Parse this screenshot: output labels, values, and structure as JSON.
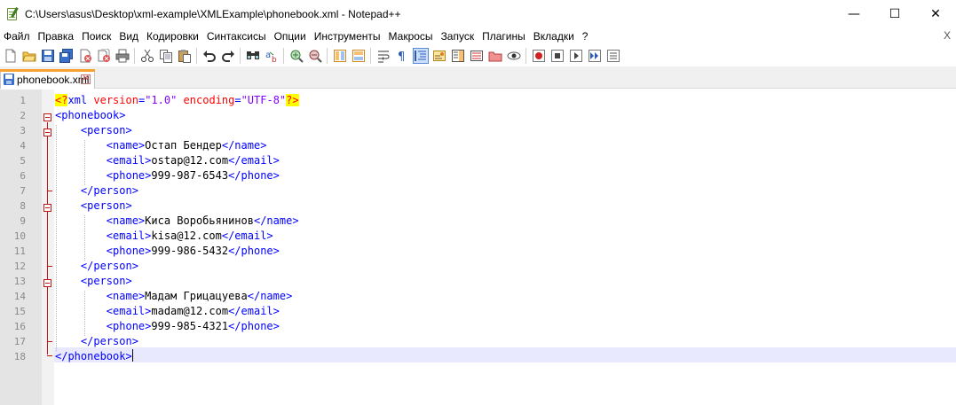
{
  "window": {
    "title": "C:\\Users\\asus\\Desktop\\xml-example\\XMLExample\\phonebook.xml - Notepad++",
    "minimize_label": "—",
    "maximize_label": "☐",
    "close_label": "✕"
  },
  "menu": {
    "items": [
      "Файл",
      "Правка",
      "Поиск",
      "Вид",
      "Кодировки",
      "Синтаксисы",
      "Опции",
      "Инструменты",
      "Макросы",
      "Запуск",
      "Плагины",
      "Вкладки",
      "?"
    ],
    "close_label": "X"
  },
  "toolbar": {
    "icons": [
      "new-file-icon",
      "open-file-icon",
      "save-icon",
      "save-all-icon",
      "close-icon",
      "close-all-icon",
      "print-icon",
      "cut-icon",
      "copy-icon",
      "paste-icon",
      "undo-icon",
      "redo-icon",
      "find-icon",
      "replace-icon",
      "zoom-in-icon",
      "zoom-out-icon",
      "sync-vertical-icon",
      "sync-horizontal-icon",
      "word-wrap-icon",
      "show-all-chars-icon",
      "indent-guide-icon",
      "user-language-icon",
      "document-map-icon",
      "function-list-icon",
      "folder-as-workspace-icon",
      "monitoring-icon",
      "record-macro-icon",
      "stop-macro-icon",
      "play-macro-icon",
      "run-macro-multiple-icon",
      "save-macro-icon"
    ]
  },
  "tab": {
    "label": "phonebook.xml",
    "close_label": "✕"
  },
  "editor": {
    "lines": [
      {
        "n": "1"
      },
      {
        "n": "2"
      },
      {
        "n": "3"
      },
      {
        "n": "4"
      },
      {
        "n": "5"
      },
      {
        "n": "6"
      },
      {
        "n": "7"
      },
      {
        "n": "8"
      },
      {
        "n": "9"
      },
      {
        "n": "10"
      },
      {
        "n": "11"
      },
      {
        "n": "12"
      },
      {
        "n": "13"
      },
      {
        "n": "14"
      },
      {
        "n": "15"
      },
      {
        "n": "16"
      },
      {
        "n": "17"
      },
      {
        "n": "18"
      }
    ],
    "xml_decl": {
      "open": "<?",
      "name": "xml",
      "attr1": "version",
      "eq": "=",
      "val1": "\"1.0\"",
      "attr2": "encoding",
      "val2": "\"UTF-8\"",
      "close": "?>"
    },
    "root_open": "<phonebook>",
    "root_close": "</phonebook>",
    "person_open": "<person>",
    "person_close": "</person>",
    "persons": [
      {
        "name_open": "<name>",
        "name": "Остап Бендер",
        "name_close": "</name>",
        "email_open": "<email>",
        "email": "ostap@12.com",
        "email_close": "</email>",
        "phone_open": "<phone>",
        "phone": "999-987-6543",
        "phone_close": "</phone>"
      },
      {
        "name_open": "<name>",
        "name": "Киса Воробьянинов",
        "name_close": "</name>",
        "email_open": "<email>",
        "email": "kisa@12.com",
        "email_close": "</email>",
        "phone_open": "<phone>",
        "phone": "999-986-5432",
        "phone_close": "</phone>"
      },
      {
        "name_open": "<name>",
        "name": "Мадам Грицацуева",
        "name_close": "</name>",
        "email_open": "<email>",
        "email": "madam@12.com",
        "email_close": "</email>",
        "phone_open": "<phone>",
        "phone": "999-985-4321",
        "phone_close": "</phone>"
      }
    ]
  },
  "colors": {
    "tag": "#0000ff",
    "attr": "#ff0000",
    "value": "#8000ff",
    "current_line": "#e8e8ff",
    "fold_marker": "#c01818",
    "tab_accent": "#f7a131"
  }
}
